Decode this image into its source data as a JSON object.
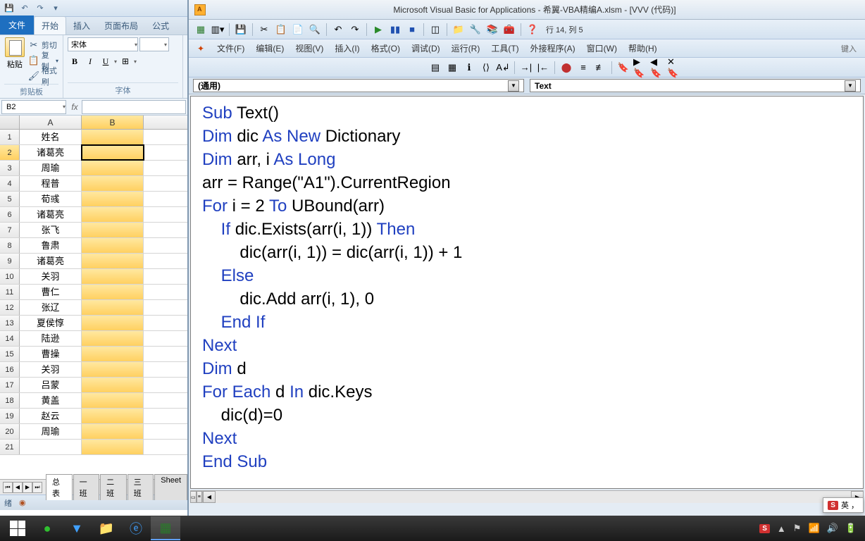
{
  "excel": {
    "tabs": {
      "file": "文件",
      "home": "开始",
      "insert": "插入",
      "layout": "页面布局",
      "formula": "公式"
    },
    "clipboard": {
      "paste": "粘贴",
      "cut": "剪切",
      "copy": "复制",
      "painter": "格式刷",
      "group": "剪贴板"
    },
    "font": {
      "name": "宋体",
      "group": "字体",
      "bold": "B",
      "italic": "I",
      "underline": "U"
    },
    "namebox": "B2",
    "columns": [
      "A",
      "B"
    ],
    "rows": [
      {
        "n": "1",
        "a": "姓名",
        "b": ""
      },
      {
        "n": "2",
        "a": "诸葛亮",
        "b": ""
      },
      {
        "n": "3",
        "a": "周瑜",
        "b": ""
      },
      {
        "n": "4",
        "a": "程普",
        "b": ""
      },
      {
        "n": "5",
        "a": "荀彧",
        "b": ""
      },
      {
        "n": "6",
        "a": "诸葛亮",
        "b": ""
      },
      {
        "n": "7",
        "a": "张飞",
        "b": ""
      },
      {
        "n": "8",
        "a": "鲁肃",
        "b": ""
      },
      {
        "n": "9",
        "a": "诸葛亮",
        "b": ""
      },
      {
        "n": "10",
        "a": "关羽",
        "b": ""
      },
      {
        "n": "11",
        "a": "曹仁",
        "b": ""
      },
      {
        "n": "12",
        "a": "张辽",
        "b": ""
      },
      {
        "n": "13",
        "a": "夏侯惇",
        "b": ""
      },
      {
        "n": "14",
        "a": "陆逊",
        "b": ""
      },
      {
        "n": "15",
        "a": "曹操",
        "b": ""
      },
      {
        "n": "16",
        "a": "关羽",
        "b": ""
      },
      {
        "n": "17",
        "a": "吕蒙",
        "b": ""
      },
      {
        "n": "18",
        "a": "黄盖",
        "b": ""
      },
      {
        "n": "19",
        "a": "赵云",
        "b": ""
      },
      {
        "n": "20",
        "a": "周瑜",
        "b": ""
      },
      {
        "n": "21",
        "a": "",
        "b": ""
      }
    ],
    "sheets": [
      "总表",
      "一班",
      "二班",
      "三班",
      "Sheet"
    ],
    "status": "绪"
  },
  "vba": {
    "title": "Microsoft Visual Basic for Applications - 希翼-VBA精编A.xlsm - [VVV (代码)]",
    "pos": "行 14, 列 5",
    "menus": {
      "file": "文件(F)",
      "edit": "编辑(E)",
      "view": "视图(V)",
      "insert": "插入(I)",
      "format": "格式(O)",
      "debug": "调试(D)",
      "run": "运行(R)",
      "tools": "工具(T)",
      "addins": "外接程序(A)",
      "window": "窗口(W)",
      "help": "帮助(H)",
      "keyin": "键入"
    },
    "dd_left": "(通用)",
    "dd_right": "Text",
    "code": [
      {
        "t": "Sub ",
        "k": 1
      },
      {
        "t": "Text()\n"
      },
      {
        "t": "Dim ",
        "k": 1
      },
      {
        "t": "dic "
      },
      {
        "t": "As New ",
        "k": 1
      },
      {
        "t": "Dictionary\n"
      },
      {
        "t": "Dim ",
        "k": 1
      },
      {
        "t": "arr, i "
      },
      {
        "t": "As Long",
        "k": 1
      },
      {
        "t": "\n"
      },
      {
        "t": "arr = Range(\"A1\").CurrentRegion\n"
      },
      {
        "t": "For ",
        "k": 1
      },
      {
        "t": "i = 2 "
      },
      {
        "t": "To ",
        "k": 1
      },
      {
        "t": "UBound(arr)\n"
      },
      {
        "t": "    If ",
        "k": 1
      },
      {
        "t": "dic.Exists(arr(i, 1)) "
      },
      {
        "t": "Then",
        "k": 1
      },
      {
        "t": "\n"
      },
      {
        "t": "        dic(arr(i, 1)) = dic(arr(i, 1)) + 1\n"
      },
      {
        "t": "    Else",
        "k": 1
      },
      {
        "t": "\n"
      },
      {
        "t": "        dic.Add arr(i, 1), 0\n"
      },
      {
        "t": "    End If",
        "k": 1
      },
      {
        "t": "\n"
      },
      {
        "t": "Next",
        "k": 1
      },
      {
        "t": "\n"
      },
      {
        "t": "Dim ",
        "k": 1
      },
      {
        "t": "d\n"
      },
      {
        "t": "For Each ",
        "k": 1
      },
      {
        "t": "d "
      },
      {
        "t": "In ",
        "k": 1
      },
      {
        "t": "dic.Keys\n"
      },
      {
        "t": "    dic(d)=0\n"
      },
      {
        "t": "Next",
        "k": 1
      },
      {
        "t": "\n"
      },
      {
        "t": "End Sub",
        "k": 1
      }
    ]
  },
  "ime": {
    "badge": "S",
    "text": "英 ，"
  },
  "tray": {
    "up": "▲"
  }
}
